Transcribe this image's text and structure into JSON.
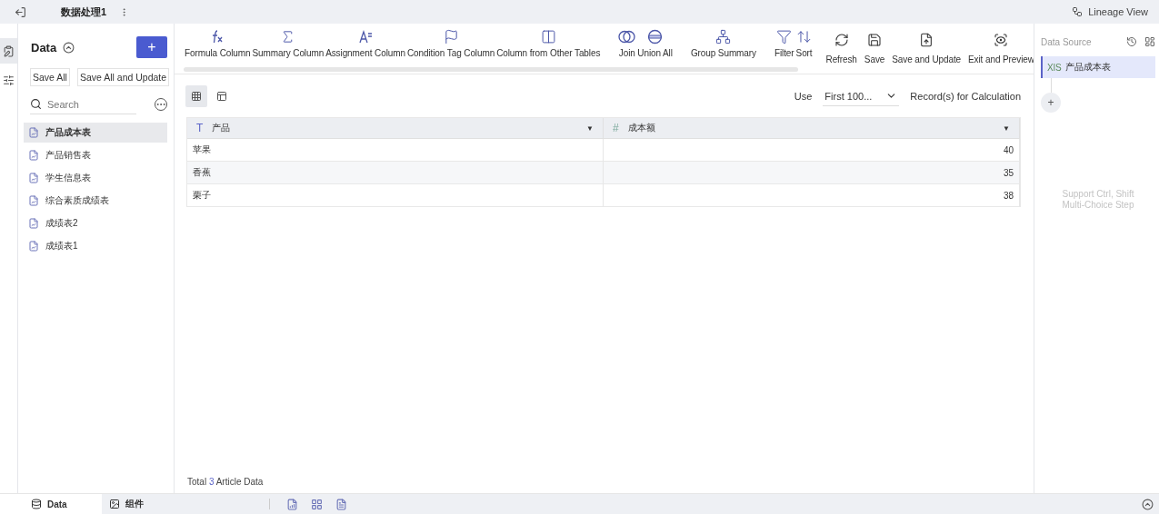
{
  "topbar": {
    "title": "数据处理1",
    "lineage": "Lineage View"
  },
  "rail": [
    {
      "selected": true
    },
    {
      "selected": false
    }
  ],
  "sidebar": {
    "title": "Data",
    "add": "+",
    "buttons": [
      "Save All",
      "Save All and Update"
    ],
    "search": {
      "placeholder": "Search"
    },
    "items": [
      {
        "label": "产品成本表",
        "selected": true
      },
      {
        "label": "产品销售表",
        "selected": false
      },
      {
        "label": "学生信息表",
        "selected": false
      },
      {
        "label": "综合素质成绩表",
        "selected": false
      },
      {
        "label": "成绩表2",
        "selected": false
      },
      {
        "label": "成绩表1",
        "selected": false
      }
    ]
  },
  "toolbar": {
    "groups": [
      {
        "kind": "tools",
        "items": [
          {
            "label": "Formula Column"
          },
          {
            "label": "Summary Column"
          },
          {
            "label": "Assignment Column"
          },
          {
            "label": "Condition Tag Column"
          },
          {
            "label": "Column from Other Tables"
          }
        ]
      },
      {
        "kind": "tools",
        "items": [
          {
            "label": "Join"
          },
          {
            "label": "Union All"
          }
        ]
      },
      {
        "kind": "tools",
        "items": [
          {
            "label": "Group Summary"
          }
        ]
      },
      {
        "kind": "tools",
        "items": [
          {
            "label": "Filter"
          },
          {
            "label": "Sort"
          }
        ]
      },
      {
        "kind": "actions",
        "items": [
          {
            "label": "Refresh"
          },
          {
            "label": "Save"
          },
          {
            "label": "Save and Update"
          },
          {
            "label": "Exit and Preview"
          }
        ]
      }
    ]
  },
  "view_toggles": [
    {
      "kind": "grid",
      "selected": true
    },
    {
      "kind": "layout",
      "selected": false
    }
  ],
  "records": {
    "use": "Use",
    "value": "First 100...",
    "suffix": "Record(s) for Calculation"
  },
  "table": {
    "columns": [
      {
        "kind": "text",
        "type_icon": "T",
        "name": "产品",
        "menu": "▼"
      },
      {
        "kind": "number",
        "type_icon": "#",
        "name": "成本额",
        "menu": "▼"
      }
    ],
    "rows": [
      [
        "苹果",
        "40"
      ],
      [
        "香蕉",
        "35"
      ],
      [
        "栗子",
        "38"
      ]
    ]
  },
  "footer": {
    "prefix": "Total",
    "count": "3",
    "suffix": "Article Data"
  },
  "data_source": {
    "title": "Data Source",
    "node": {
      "file_type": "XlS",
      "label": "产品成本表",
      "selected": true
    },
    "add": "+",
    "hint": [
      "Support Ctrl, Shift",
      "Multi-Choice Step"
    ]
  },
  "bottom": {
    "tabs": [
      {
        "label": "Data",
        "selected": true
      },
      {
        "label": "组件",
        "selected": false
      }
    ]
  }
}
